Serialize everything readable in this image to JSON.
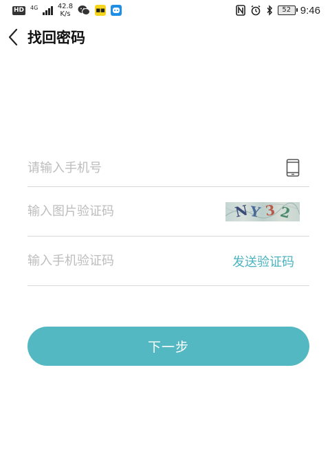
{
  "status_bar": {
    "hd": "HD",
    "network": "4G",
    "speed_value": "42.8",
    "speed_unit": "K/s",
    "battery": "52",
    "time": "9:46",
    "icons": [
      "wechat-icon",
      "yellow-app-icon",
      "blue-app-icon",
      "nfc-icon",
      "alarm-icon",
      "bluetooth-icon",
      "battery-icon"
    ]
  },
  "header": {
    "title": "找回密码"
  },
  "form": {
    "phone_placeholder": "请输入手机号",
    "phone_value": "",
    "image_code_placeholder": "输入图片验证码",
    "image_code_value": "",
    "captcha_text": "NY32",
    "sms_code_placeholder": "输入手机验证码",
    "sms_code_value": "",
    "send_code_label": "发送验证码"
  },
  "actions": {
    "next_label": "下一步"
  },
  "colors": {
    "accent": "#53b8c1",
    "link": "#4ab3bf",
    "placeholder": "#bdbdbd",
    "divider": "#d8d8d8"
  }
}
